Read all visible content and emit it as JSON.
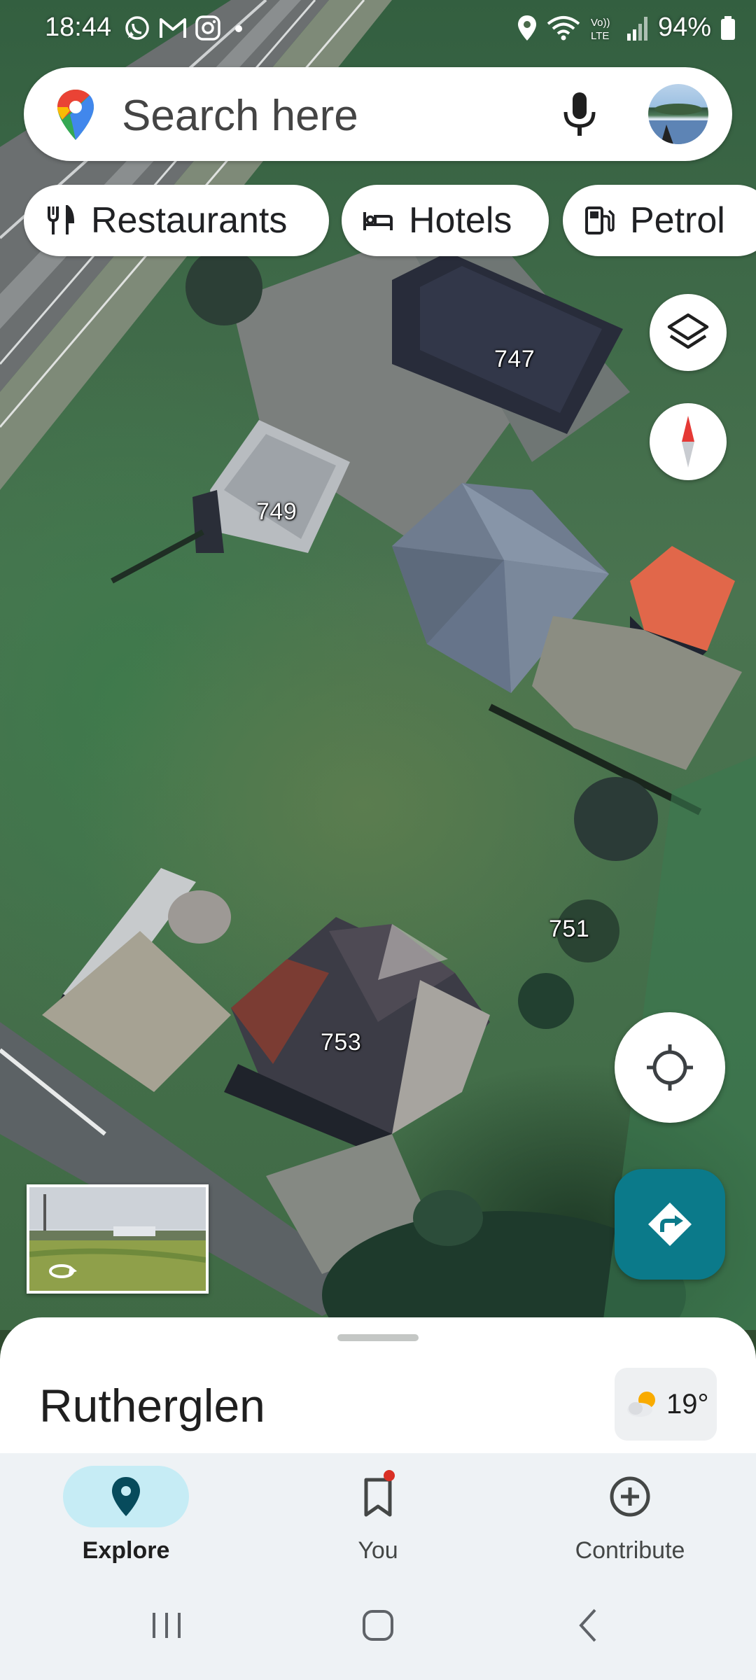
{
  "status_bar": {
    "time": "18:44",
    "battery": "94%",
    "left_icons": [
      "whatsapp-icon",
      "gmail-icon",
      "instagram-icon",
      "dot-icon"
    ],
    "right_icons": [
      "location-icon",
      "wifi-icon",
      "volte-icon",
      "signal-icon",
      "battery-icon"
    ]
  },
  "search": {
    "placeholder": "Search here",
    "logo_icon": "google-maps-pin-icon",
    "mic_icon": "microphone-icon"
  },
  "chips": [
    {
      "label": "Restaurants",
      "icon": "fork-knife-icon"
    },
    {
      "label": "Hotels",
      "icon": "bed-icon"
    },
    {
      "label": "Petrol",
      "icon": "fuel-pump-icon"
    }
  ],
  "map": {
    "house_numbers": [
      "747",
      "749",
      "751",
      "753"
    ],
    "controls": [
      "layers-icon",
      "compass-icon",
      "my-location-icon",
      "directions-icon"
    ]
  },
  "bottom_sheet": {
    "title": "Rutherglen",
    "temperature": "19°",
    "weather_icon": "partly-sunny-icon"
  },
  "nav": {
    "explore": "Explore",
    "you": "You",
    "contribute": "Contribute"
  },
  "colors": {
    "directions_fab": "#0b7a8a",
    "explore_pill": "#c6ecf5",
    "nav_background": "#eef2f5",
    "notification_dot": "#d93025"
  }
}
